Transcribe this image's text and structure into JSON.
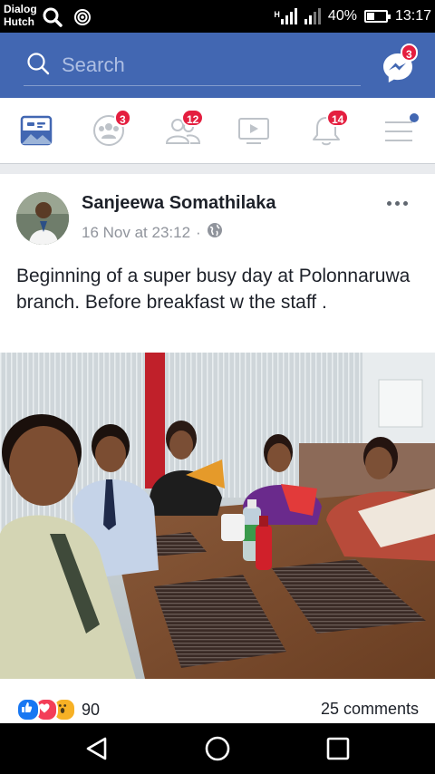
{
  "status_bar": {
    "carrier_line1": "Dialog",
    "carrier_line2": "Hutch",
    "network_type": "H",
    "battery_percent": "40%",
    "battery_level": 0.4,
    "time": "13:17"
  },
  "header": {
    "search_placeholder": "Search",
    "messenger_badge": "3"
  },
  "tabs": [
    {
      "name": "news-feed",
      "badge": ""
    },
    {
      "name": "groups",
      "badge": "3"
    },
    {
      "name": "friend-requests",
      "badge": "12"
    },
    {
      "name": "watch",
      "badge": ""
    },
    {
      "name": "notifications",
      "badge": "14"
    },
    {
      "name": "menu",
      "badge": ""
    }
  ],
  "post": {
    "author": "Sanjeewa Somathilaka",
    "timestamp": "16 Nov at 23:12",
    "separator": "·",
    "privacy_icon": "globe-icon",
    "text": "Beginning of a super busy day at Polonnaruwa branch. Before breakfast w the staff .",
    "reaction_count": "90",
    "comments_count": "25 comments"
  },
  "colors": {
    "header": "#4267b2",
    "badge": "#e41e3f",
    "like": "#1877f2",
    "love": "#f33e58",
    "wow": "#f7b125"
  }
}
